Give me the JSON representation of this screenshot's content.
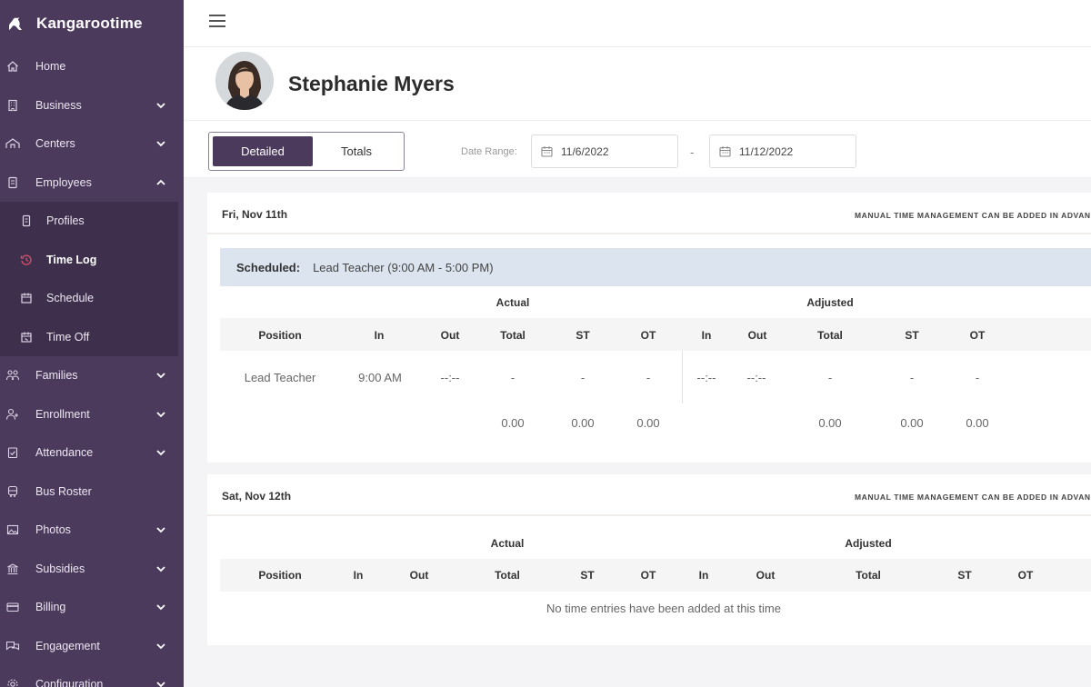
{
  "app": {
    "name": "Kangarootime"
  },
  "sidebar": {
    "items": [
      {
        "label": "Home",
        "icon": "home-icon",
        "expandable": false
      },
      {
        "label": "Business",
        "icon": "building-icon",
        "expandable": true
      },
      {
        "label": "Centers",
        "icon": "school-icon",
        "expandable": true
      },
      {
        "label": "Employees",
        "icon": "badge-icon",
        "expandable": true,
        "expanded": true
      },
      {
        "label": "Families",
        "icon": "family-icon",
        "expandable": true
      },
      {
        "label": "Enrollment",
        "icon": "user-plus-icon",
        "expandable": true
      },
      {
        "label": "Attendance",
        "icon": "clipboard-check-icon",
        "expandable": true
      },
      {
        "label": "Bus Roster",
        "icon": "bus-icon",
        "expandable": false
      },
      {
        "label": "Photos",
        "icon": "photo-icon",
        "expandable": true
      },
      {
        "label": "Subsidies",
        "icon": "bank-icon",
        "expandable": true
      },
      {
        "label": "Billing",
        "icon": "credit-card-icon",
        "expandable": true
      },
      {
        "label": "Engagement",
        "icon": "chat-icon",
        "expandable": true
      },
      {
        "label": "Configuration",
        "icon": "gear-icon",
        "expandable": true
      }
    ],
    "employees_sub": [
      {
        "label": "Profiles",
        "icon": "id-card-icon"
      },
      {
        "label": "Time Log",
        "icon": "history-icon",
        "active": true
      },
      {
        "label": "Schedule",
        "icon": "calendar-icon"
      },
      {
        "label": "Time Off",
        "icon": "calendar-off-icon"
      }
    ]
  },
  "profile": {
    "name": "Stephanie Myers"
  },
  "controls": {
    "tabs": [
      {
        "label": "Detailed",
        "active": true
      },
      {
        "label": "Totals",
        "active": false
      }
    ],
    "date_range_label": "Date Range:",
    "start_date": "11/6/2022",
    "end_date": "11/12/2022",
    "separator": "-"
  },
  "columns": {
    "group_actual": "Actual",
    "group_adjusted": "Adjusted",
    "position": "Position",
    "in": "In",
    "out": "Out",
    "total": "Total",
    "st": "ST",
    "ot": "OT"
  },
  "days": [
    {
      "date": "Fri, Nov 11th",
      "note": "MANUAL TIME MANAGEMENT CAN BE ADDED IN ADVANCE",
      "scheduled_label": "Scheduled:",
      "scheduled_value": "Lead Teacher (9:00 AM - 5:00 PM)",
      "row": {
        "position": "Lead Teacher",
        "actual_in": "9:00 AM",
        "actual_out": "--:--",
        "actual_total": "-",
        "actual_st": "-",
        "actual_ot": "-",
        "adj_in": "--:--",
        "adj_out": "--:--",
        "adj_total": "-",
        "adj_st": "-",
        "adj_ot": "-"
      },
      "totals": {
        "actual_total": "0.00",
        "actual_st": "0.00",
        "actual_ot": "0.00",
        "adj_total": "0.00",
        "adj_st": "0.00",
        "adj_ot": "0.00"
      }
    },
    {
      "date": "Sat, Nov 12th",
      "note": "MANUAL TIME MANAGEMENT CAN BE ADDED IN ADVANCE",
      "empty_message": "No time entries have been added at this time"
    }
  ]
}
